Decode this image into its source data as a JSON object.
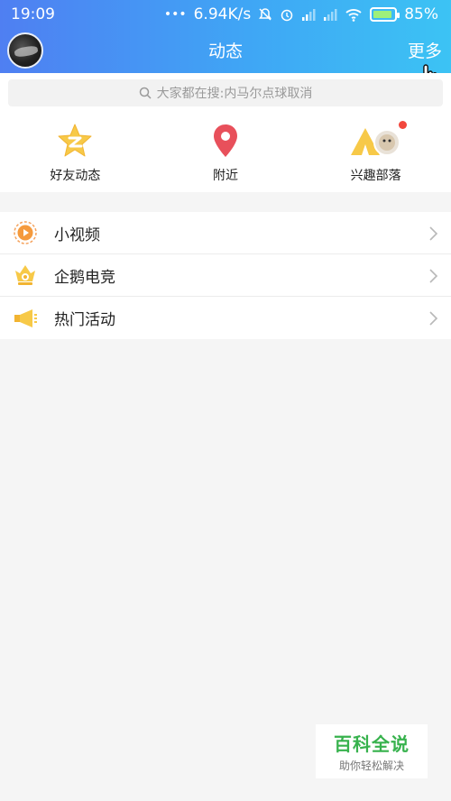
{
  "status_bar": {
    "time": "19:09",
    "dots": "•••",
    "network_speed": "6.94K/s",
    "battery_percent": "85%"
  },
  "header": {
    "title": "动态",
    "more_label": "更多"
  },
  "search": {
    "placeholder_text": "大家都在搜:内马尔点球取消"
  },
  "shortcuts": [
    {
      "label": "好友动态",
      "icon": "friends-qzone-star-icon"
    },
    {
      "label": "附近",
      "icon": "location-pin-icon"
    },
    {
      "label": "兴趣部落",
      "icon": "tribe-tent-icon"
    }
  ],
  "menu": [
    {
      "label": "小视频",
      "icon": "video-play-icon"
    },
    {
      "label": "企鹅电竞",
      "icon": "esports-crown-icon"
    },
    {
      "label": "热门活动",
      "icon": "megaphone-icon"
    }
  ],
  "watermark": {
    "title": "百科全说",
    "subtitle": "助你轻松解决"
  },
  "colors": {
    "header_gradient_start": "#4f7ff2",
    "header_gradient_end": "#3cc3f4",
    "accent_yellow": "#f7c948",
    "pin_red": "#e8505b",
    "watermark_green": "#37b24d"
  }
}
